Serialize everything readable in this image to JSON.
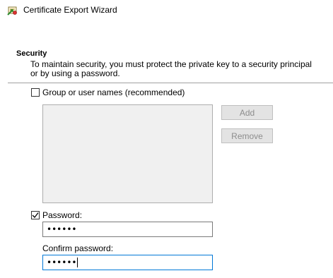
{
  "window": {
    "title": "Certificate Export Wizard",
    "icon": "certificate-icon"
  },
  "security": {
    "heading": "Security",
    "description": "To maintain security, you must protect the private key to a security principal or by using a password."
  },
  "group_option": {
    "label": "Group or user names (recommended)",
    "checked": false
  },
  "buttons": {
    "add_label": "Add",
    "remove_label": "Remove"
  },
  "password_option": {
    "label": "Password:",
    "checked": true,
    "value_masked": "••••••"
  },
  "confirm_password": {
    "label": "Confirm password:",
    "value_masked": "••••••"
  },
  "colors": {
    "focus_border": "#0078d7",
    "disabled_text": "#8d8d8d",
    "disabled_bg": "#f0f0f0"
  }
}
